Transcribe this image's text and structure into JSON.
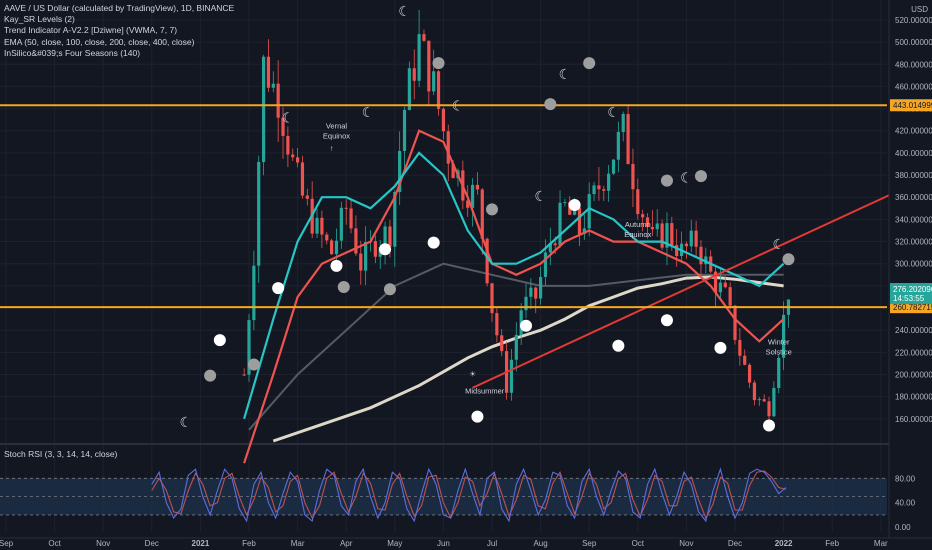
{
  "legend": {
    "title": "AAVE / US Dollar (calculated by TradingView), 1D, BINANCE",
    "ind1": "Kay_SR Levels (2)",
    "ind2": "Trend Indicator A-V2.2 [Dziwne] (VWMA, 7, 7)",
    "ind3": "EMA (50, close, 100, close, 200, close, 400, close)",
    "ind4": "InSilico&#039;s Four Seasons (140)"
  },
  "rsi_legend": "Stoch RSI (3, 3, 14, 14, close)",
  "colors": {
    "background": "#131722",
    "grid": "#1e222d",
    "level_line": "#f5a623",
    "trendline": "#e53935",
    "ema_teal": "#26c6c6",
    "ema_red": "#ef5350",
    "ema_gray": "#555a64",
    "ema_cream": "#ddd8c8",
    "price_badge": "#26a69a",
    "rsi_k": "#5b6ee1",
    "rsi_d": "#c0504d",
    "rsi_band": "#1c2f47"
  },
  "chart_data": [
    {
      "type": "candlestick",
      "y_axis": {
        "unit": "USD",
        "range": [
          140,
          538
        ],
        "ticks": [
          "160.000000",
          "180.000000",
          "200.000000",
          "220.000000",
          "240.000000",
          "260.000000",
          "280.000000",
          "300.000000",
          "320.000000",
          "340.000000",
          "360.000000",
          "380.000000",
          "400.000000",
          "420.000000",
          "440.000000",
          "460.000000",
          "480.000000",
          "500.000000",
          "520.000000"
        ],
        "tick_values": [
          160,
          180,
          200,
          220,
          240,
          260,
          280,
          300,
          320,
          340,
          360,
          380,
          400,
          420,
          440,
          460,
          480,
          500,
          520
        ]
      },
      "x_axis": {
        "labels": [
          "Sep",
          "Oct",
          "Nov",
          "Dec",
          "2021",
          "Feb",
          "Mar",
          "Apr",
          "May",
          "Jun",
          "Jul",
          "Aug",
          "Sep",
          "Oct",
          "Nov",
          "Dec",
          "2022",
          "Feb",
          "Mar"
        ],
        "bold": [
          "2021",
          "2022"
        ],
        "months_from_sep_2020": [
          0,
          1,
          2,
          3,
          4,
          5,
          6,
          7,
          8,
          9,
          10,
          11,
          12,
          13,
          14,
          15,
          16,
          17,
          18
        ]
      },
      "price_series": {
        "months": [
          4.9,
          5.1,
          5.3,
          5.6,
          5.9,
          6.1,
          6.4,
          6.7,
          7.0,
          7.3,
          7.6,
          7.9,
          8.2,
          8.5,
          8.8,
          9.1,
          9.4,
          9.7,
          10.0,
          10.3,
          10.6,
          10.9,
          11.2,
          11.5,
          11.8,
          12.1,
          12.4,
          12.7,
          13.0,
          13.3,
          13.6,
          13.9,
          14.2,
          14.5,
          14.8,
          15.1,
          15.4,
          15.7,
          16.0,
          16.1
        ],
        "close": [
          200,
          310,
          480,
          450,
          390,
          360,
          330,
          310,
          350,
          300,
          320,
          330,
          440,
          500,
          460,
          400,
          370,
          360,
          260,
          190,
          260,
          270,
          320,
          350,
          330,
          360,
          390,
          420,
          360,
          320,
          330,
          310,
          320,
          290,
          270,
          220,
          180,
          170,
          250,
          276
        ]
      },
      "ema_teal": {
        "months": [
          4.9,
          5.5,
          6.0,
          6.5,
          7.0,
          7.5,
          8.0,
          8.5,
          9.0,
          9.5,
          10.0,
          10.5,
          11.0,
          11.5,
          12.0,
          12.5,
          13.0,
          13.5,
          14.0,
          14.5,
          15.0,
          15.5,
          16.0
        ],
        "values": [
          160,
          250,
          320,
          360,
          360,
          350,
          370,
          400,
          380,
          330,
          300,
          300,
          310,
          330,
          350,
          340,
          320,
          320,
          310,
          300,
          290,
          280,
          300
        ]
      },
      "ema_red": {
        "months": [
          4.9,
          5.5,
          6.0,
          6.5,
          7.0,
          7.5,
          8.0,
          8.5,
          9.0,
          9.5,
          10.0,
          10.5,
          11.0,
          11.5,
          12.0,
          12.5,
          13.0,
          13.5,
          14.0,
          14.5,
          15.0,
          15.5,
          16.0
        ],
        "values": [
          120,
          200,
          270,
          300,
          310,
          320,
          360,
          420,
          410,
          360,
          300,
          290,
          300,
          320,
          330,
          320,
          320,
          310,
          300,
          280,
          250,
          230,
          250
        ]
      },
      "ema_gray": {
        "months": [
          5.0,
          6.0,
          7.0,
          8.0,
          9.0,
          10.0,
          11.0,
          12.0,
          13.0,
          14.0,
          15.0,
          16.0
        ],
        "values": [
          150,
          200,
          240,
          280,
          300,
          290,
          280,
          280,
          285,
          290,
          290,
          290
        ]
      },
      "ema_cream": {
        "months": [
          5.5,
          6.5,
          7.5,
          8.5,
          9.5,
          10.0,
          10.5,
          11.0,
          11.5,
          12.0,
          12.5,
          13.0,
          13.5,
          14.0,
          14.5,
          15.0,
          15.5,
          16.0
        ],
        "values": [
          140,
          155,
          170,
          190,
          215,
          225,
          233,
          240,
          250,
          262,
          270,
          278,
          282,
          287,
          288,
          286,
          283,
          280
        ]
      },
      "levels": [
        {
          "value": 443.014999,
          "label": "443.014999"
        },
        {
          "value": 260.782715,
          "label": "260.782715"
        }
      ],
      "trendline": {
        "from": {
          "month": 9.6,
          "value": 188
        },
        "to": {
          "month": 20.3,
          "value": 405
        }
      },
      "last_price": {
        "value": 276.202,
        "label": "276.202096",
        "countdown": "14:53:55"
      },
      "annotations": [
        {
          "text": "Vernal",
          "month": 6.8,
          "value": 422
        },
        {
          "text": "Equinox",
          "month": 6.8,
          "value": 413
        },
        {
          "text": "↑",
          "month": 6.7,
          "value": 402
        },
        {
          "text": "Midsummer",
          "month": 9.85,
          "value": 183
        },
        {
          "text": "☀",
          "month": 9.6,
          "value": 198
        },
        {
          "text": "Autumn",
          "month": 13.0,
          "value": 333
        },
        {
          "text": "Equinox",
          "month": 13.0,
          "value": 324
        },
        {
          "text": "Winter",
          "month": 15.9,
          "value": 227
        },
        {
          "text": "Solstice",
          "month": 15.9,
          "value": 218
        }
      ],
      "moons": [
        {
          "kind": "full",
          "month": 4.2,
          "value": 199
        },
        {
          "kind": "full",
          "month": 5.1,
          "value": 209
        },
        {
          "kind": "crescent",
          "month": 5.8,
          "value": 432
        },
        {
          "kind": "full",
          "month": 7.9,
          "value": 277
        },
        {
          "kind": "full",
          "month": 6.95,
          "value": 279
        },
        {
          "kind": "crescent",
          "month": 8.2,
          "value": 528
        },
        {
          "kind": "full",
          "month": 8.9,
          "value": 481
        },
        {
          "kind": "crescent",
          "month": 7.45,
          "value": 437
        },
        {
          "kind": "crescent",
          "month": 9.3,
          "value": 443
        },
        {
          "kind": "full",
          "month": 10.0,
          "value": 349
        },
        {
          "kind": "crescent",
          "month": 11.0,
          "value": 361
        },
        {
          "kind": "full",
          "month": 11.2,
          "value": 444
        },
        {
          "kind": "crescent",
          "month": 11.5,
          "value": 471
        },
        {
          "kind": "full",
          "month": 12.0,
          "value": 481
        },
        {
          "kind": "crescent",
          "month": 12.5,
          "value": 437
        },
        {
          "kind": "full",
          "month": 13.6,
          "value": 375
        },
        {
          "kind": "crescent",
          "month": 14.0,
          "value": 378
        },
        {
          "kind": "full",
          "month": 14.3,
          "value": 379
        },
        {
          "kind": "crescent",
          "month": 15.9,
          "value": 318
        },
        {
          "kind": "full",
          "month": 16.1,
          "value": 304
        },
        {
          "kind": "crescent",
          "month": 3.7,
          "value": 157
        }
      ],
      "suns": [
        {
          "month": 4.4,
          "value": 231
        },
        {
          "month": 5.6,
          "value": 278
        },
        {
          "month": 6.8,
          "value": 298
        },
        {
          "month": 7.8,
          "value": 313
        },
        {
          "month": 8.8,
          "value": 319
        },
        {
          "month": 9.7,
          "value": 162
        },
        {
          "month": 10.7,
          "value": 244
        },
        {
          "month": 11.7,
          "value": 353
        },
        {
          "month": 12.6,
          "value": 226
        },
        {
          "month": 13.6,
          "value": 249
        },
        {
          "month": 14.7,
          "value": 224
        },
        {
          "month": 15.7,
          "value": 154
        }
      ]
    },
    {
      "type": "line",
      "title": "Stoch RSI (3, 3, 14, 14, close)",
      "y_axis": {
        "range": [
          -8,
          110
        ],
        "ticks": [
          "0.00",
          "40.00",
          "80.00"
        ],
        "tick_values": [
          0,
          40,
          80
        ]
      },
      "band": [
        20,
        80
      ],
      "series": [
        {
          "name": "K",
          "months": [
            3.0,
            3.15,
            3.3,
            3.45,
            3.6,
            3.75,
            3.9,
            4.05,
            4.2,
            4.35,
            4.5,
            4.65,
            4.8,
            4.95,
            5.1,
            5.25,
            5.4,
            5.55,
            5.7,
            5.85,
            6.0,
            6.15,
            6.3,
            6.45,
            6.6,
            6.75,
            6.9,
            7.05,
            7.2,
            7.35,
            7.5,
            7.65,
            7.8,
            7.95,
            8.1,
            8.25,
            8.4,
            8.55,
            8.7,
            8.85,
            9.0,
            9.15,
            9.3,
            9.45,
            9.6,
            9.75,
            9.9,
            10.05,
            10.2,
            10.35,
            10.5,
            10.65,
            10.8,
            10.95,
            11.1,
            11.25,
            11.4,
            11.55,
            11.7,
            11.85,
            12.0,
            12.15,
            12.3,
            12.45,
            12.6,
            12.75,
            12.9,
            13.05,
            13.2,
            13.35,
            13.5,
            13.65,
            13.8,
            13.95,
            14.1,
            14.25,
            14.4,
            14.55,
            14.7,
            14.85,
            15.0,
            15.15,
            15.3,
            15.45,
            15.6,
            15.75,
            15.9,
            16.05
          ],
          "values": [
            70,
            90,
            40,
            15,
            30,
            85,
            95,
            50,
            20,
            60,
            95,
            80,
            30,
            10,
            70,
            90,
            40,
            15,
            55,
            90,
            75,
            20,
            10,
            60,
            95,
            85,
            35,
            20,
            75,
            95,
            50,
            15,
            40,
            90,
            80,
            30,
            10,
            55,
            95,
            70,
            20,
            15,
            60,
            95,
            55,
            20,
            80,
            90,
            30,
            10,
            70,
            95,
            60,
            20,
            45,
            90,
            85,
            35,
            15,
            75,
            95,
            50,
            20,
            60,
            92,
            80,
            25,
            15,
            70,
            95,
            55,
            20,
            50,
            90,
            70,
            25,
            10,
            60,
            95,
            50,
            15,
            40,
            88,
            95,
            90,
            75,
            55,
            65
          ]
        },
        {
          "name": "D",
          "months": [
            3.0,
            3.15,
            3.3,
            3.45,
            3.6,
            3.75,
            3.9,
            4.05,
            4.2,
            4.35,
            4.5,
            4.65,
            4.8,
            4.95,
            5.1,
            5.25,
            5.4,
            5.55,
            5.7,
            5.85,
            6.0,
            6.15,
            6.3,
            6.45,
            6.6,
            6.75,
            6.9,
            7.05,
            7.2,
            7.35,
            7.5,
            7.65,
            7.8,
            7.95,
            8.1,
            8.25,
            8.4,
            8.55,
            8.7,
            8.85,
            9.0,
            9.15,
            9.3,
            9.45,
            9.6,
            9.75,
            9.9,
            10.05,
            10.2,
            10.35,
            10.5,
            10.65,
            10.8,
            10.95,
            11.1,
            11.25,
            11.4,
            11.55,
            11.7,
            11.85,
            12.0,
            12.15,
            12.3,
            12.45,
            12.6,
            12.75,
            12.9,
            13.05,
            13.2,
            13.35,
            13.5,
            13.65,
            13.8,
            13.95,
            14.1,
            14.25,
            14.4,
            14.55,
            14.7,
            14.85,
            15.0,
            15.15,
            15.3,
            15.45,
            15.6,
            15.75,
            15.9,
            16.05
          ],
          "values": [
            60,
            80,
            60,
            25,
            22,
            60,
            88,
            70,
            35,
            40,
            80,
            88,
            50,
            20,
            45,
            82,
            65,
            25,
            35,
            75,
            85,
            40,
            15,
            35,
            80,
            90,
            55,
            25,
            50,
            88,
            72,
            30,
            28,
            70,
            88,
            50,
            18,
            35,
            82,
            85,
            40,
            15,
            40,
            82,
            75,
            35,
            55,
            88,
            55,
            18,
            45,
            85,
            78,
            35,
            30,
            72,
            90,
            55,
            22,
            50,
            88,
            70,
            30,
            40,
            80,
            88,
            45,
            18,
            45,
            85,
            75,
            35,
            35,
            75,
            82,
            45,
            15,
            38,
            82,
            72,
            28,
            28,
            68,
            90,
            92,
            82,
            65,
            62
          ]
        }
      ]
    }
  ]
}
